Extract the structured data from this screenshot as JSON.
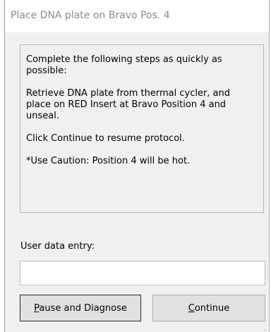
{
  "window": {
    "title": "Place DNA plate on Bravo Pos. 4"
  },
  "message": {
    "paragraphs": [
      "Complete the following steps as quickly as possible:",
      "Retrieve DNA plate from thermal cycler, and place on RED Insert at Bravo Position 4 and unseal.",
      "Click Continue to resume protocol.",
      "*Use Caution: Position 4 will be hot."
    ]
  },
  "entry": {
    "label": "User data entry:",
    "value": "",
    "placeholder": ""
  },
  "buttons": {
    "pause": {
      "mnemonic": "P",
      "rest": "ause and Diagnose"
    },
    "continue": {
      "mnemonic": "C",
      "rest": "ontinue"
    }
  }
}
